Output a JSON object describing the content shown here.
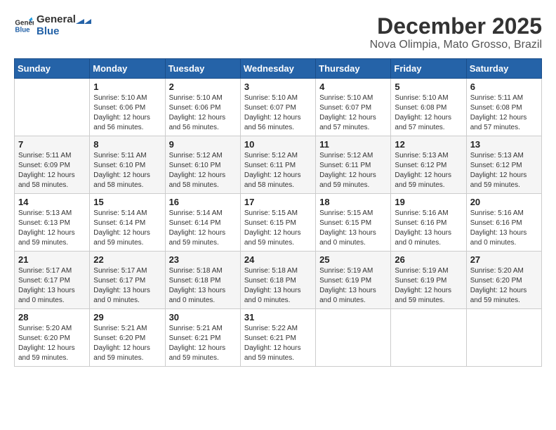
{
  "header": {
    "logo_line1": "General",
    "logo_line2": "Blue",
    "month_title": "December 2025",
    "subtitle": "Nova Olimpia, Mato Grosso, Brazil"
  },
  "weekdays": [
    "Sunday",
    "Monday",
    "Tuesday",
    "Wednesday",
    "Thursday",
    "Friday",
    "Saturday"
  ],
  "weeks": [
    [
      {
        "day": "",
        "info": ""
      },
      {
        "day": "1",
        "info": "Sunrise: 5:10 AM\nSunset: 6:06 PM\nDaylight: 12 hours\nand 56 minutes."
      },
      {
        "day": "2",
        "info": "Sunrise: 5:10 AM\nSunset: 6:06 PM\nDaylight: 12 hours\nand 56 minutes."
      },
      {
        "day": "3",
        "info": "Sunrise: 5:10 AM\nSunset: 6:07 PM\nDaylight: 12 hours\nand 56 minutes."
      },
      {
        "day": "4",
        "info": "Sunrise: 5:10 AM\nSunset: 6:07 PM\nDaylight: 12 hours\nand 57 minutes."
      },
      {
        "day": "5",
        "info": "Sunrise: 5:10 AM\nSunset: 6:08 PM\nDaylight: 12 hours\nand 57 minutes."
      },
      {
        "day": "6",
        "info": "Sunrise: 5:11 AM\nSunset: 6:08 PM\nDaylight: 12 hours\nand 57 minutes."
      }
    ],
    [
      {
        "day": "7",
        "info": "Sunrise: 5:11 AM\nSunset: 6:09 PM\nDaylight: 12 hours\nand 58 minutes."
      },
      {
        "day": "8",
        "info": "Sunrise: 5:11 AM\nSunset: 6:10 PM\nDaylight: 12 hours\nand 58 minutes."
      },
      {
        "day": "9",
        "info": "Sunrise: 5:12 AM\nSunset: 6:10 PM\nDaylight: 12 hours\nand 58 minutes."
      },
      {
        "day": "10",
        "info": "Sunrise: 5:12 AM\nSunset: 6:11 PM\nDaylight: 12 hours\nand 58 minutes."
      },
      {
        "day": "11",
        "info": "Sunrise: 5:12 AM\nSunset: 6:11 PM\nDaylight: 12 hours\nand 59 minutes."
      },
      {
        "day": "12",
        "info": "Sunrise: 5:13 AM\nSunset: 6:12 PM\nDaylight: 12 hours\nand 59 minutes."
      },
      {
        "day": "13",
        "info": "Sunrise: 5:13 AM\nSunset: 6:12 PM\nDaylight: 12 hours\nand 59 minutes."
      }
    ],
    [
      {
        "day": "14",
        "info": "Sunrise: 5:13 AM\nSunset: 6:13 PM\nDaylight: 12 hours\nand 59 minutes."
      },
      {
        "day": "15",
        "info": "Sunrise: 5:14 AM\nSunset: 6:14 PM\nDaylight: 12 hours\nand 59 minutes."
      },
      {
        "day": "16",
        "info": "Sunrise: 5:14 AM\nSunset: 6:14 PM\nDaylight: 12 hours\nand 59 minutes."
      },
      {
        "day": "17",
        "info": "Sunrise: 5:15 AM\nSunset: 6:15 PM\nDaylight: 12 hours\nand 59 minutes."
      },
      {
        "day": "18",
        "info": "Sunrise: 5:15 AM\nSunset: 6:15 PM\nDaylight: 13 hours\nand 0 minutes."
      },
      {
        "day": "19",
        "info": "Sunrise: 5:16 AM\nSunset: 6:16 PM\nDaylight: 13 hours\nand 0 minutes."
      },
      {
        "day": "20",
        "info": "Sunrise: 5:16 AM\nSunset: 6:16 PM\nDaylight: 13 hours\nand 0 minutes."
      }
    ],
    [
      {
        "day": "21",
        "info": "Sunrise: 5:17 AM\nSunset: 6:17 PM\nDaylight: 13 hours\nand 0 minutes."
      },
      {
        "day": "22",
        "info": "Sunrise: 5:17 AM\nSunset: 6:17 PM\nDaylight: 13 hours\nand 0 minutes."
      },
      {
        "day": "23",
        "info": "Sunrise: 5:18 AM\nSunset: 6:18 PM\nDaylight: 13 hours\nand 0 minutes."
      },
      {
        "day": "24",
        "info": "Sunrise: 5:18 AM\nSunset: 6:18 PM\nDaylight: 13 hours\nand 0 minutes."
      },
      {
        "day": "25",
        "info": "Sunrise: 5:19 AM\nSunset: 6:19 PM\nDaylight: 13 hours\nand 0 minutes."
      },
      {
        "day": "26",
        "info": "Sunrise: 5:19 AM\nSunset: 6:19 PM\nDaylight: 12 hours\nand 59 minutes."
      },
      {
        "day": "27",
        "info": "Sunrise: 5:20 AM\nSunset: 6:20 PM\nDaylight: 12 hours\nand 59 minutes."
      }
    ],
    [
      {
        "day": "28",
        "info": "Sunrise: 5:20 AM\nSunset: 6:20 PM\nDaylight: 12 hours\nand 59 minutes."
      },
      {
        "day": "29",
        "info": "Sunrise: 5:21 AM\nSunset: 6:20 PM\nDaylight: 12 hours\nand 59 minutes."
      },
      {
        "day": "30",
        "info": "Sunrise: 5:21 AM\nSunset: 6:21 PM\nDaylight: 12 hours\nand 59 minutes."
      },
      {
        "day": "31",
        "info": "Sunrise: 5:22 AM\nSunset: 6:21 PM\nDaylight: 12 hours\nand 59 minutes."
      },
      {
        "day": "",
        "info": ""
      },
      {
        "day": "",
        "info": ""
      },
      {
        "day": "",
        "info": ""
      }
    ]
  ]
}
